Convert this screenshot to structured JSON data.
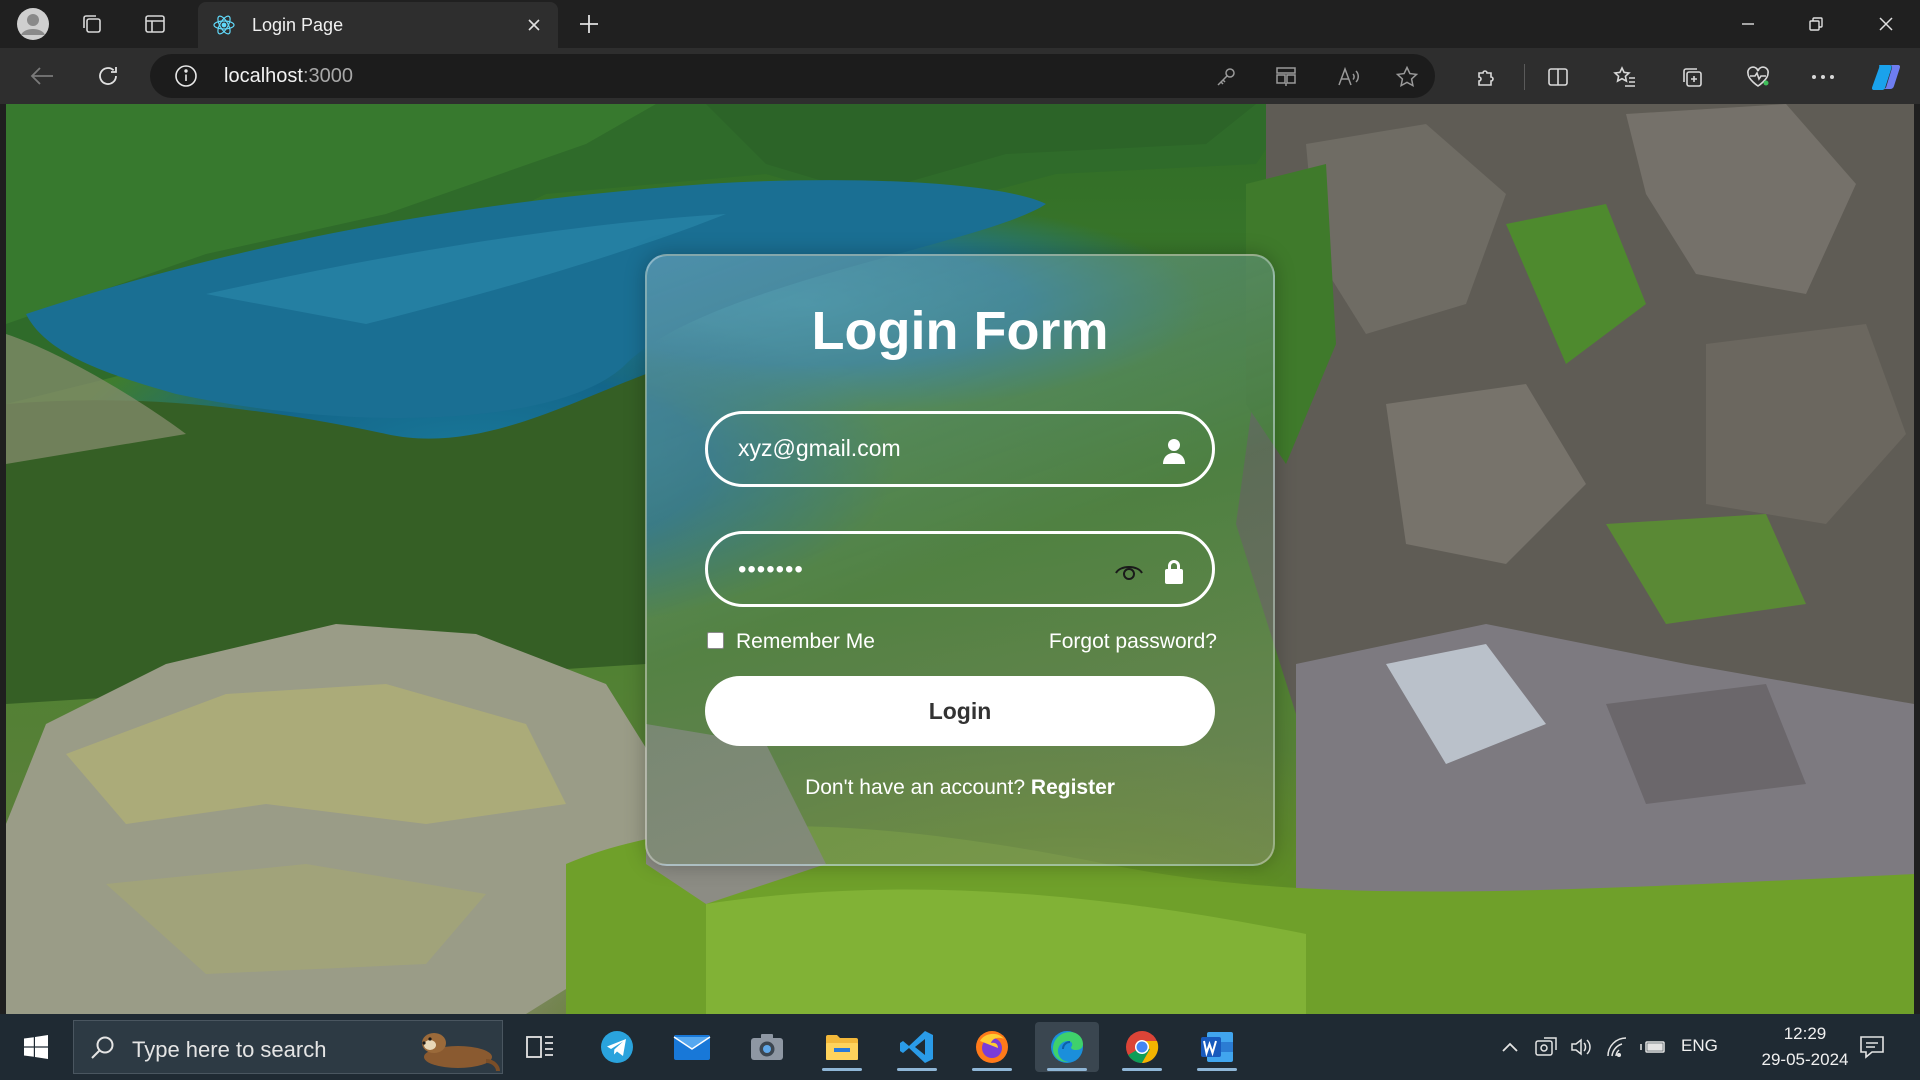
{
  "browser": {
    "tab": {
      "title": "Login Page"
    },
    "address": {
      "host": "localhost",
      "port": ":3000"
    }
  },
  "page": {
    "form_title": "Login Form",
    "email": {
      "value": "xyz@gmail.com"
    },
    "password": {
      "masked_value": "•••••••"
    },
    "remember_label": "Remember Me",
    "remember_checked": false,
    "forgot_label": "Forgot password?",
    "login_label": "Login",
    "register_prompt": "Don't have an account?",
    "register_label": "Register"
  },
  "taskbar": {
    "search_placeholder": "Type here to search",
    "apps": [
      "task-view",
      "telegram",
      "mail",
      "camera",
      "file-explorer",
      "vs-code",
      "firefox",
      "edge",
      "chrome",
      "word"
    ],
    "language": "ENG",
    "time": "12:29",
    "date": "29-05-2024"
  },
  "colors": {
    "titlebar": "#202020",
    "toolbar": "#2e2e2e",
    "taskbar": "#1f2a33",
    "card_text": "#ffffff",
    "login_button_bg": "#ffffff"
  }
}
